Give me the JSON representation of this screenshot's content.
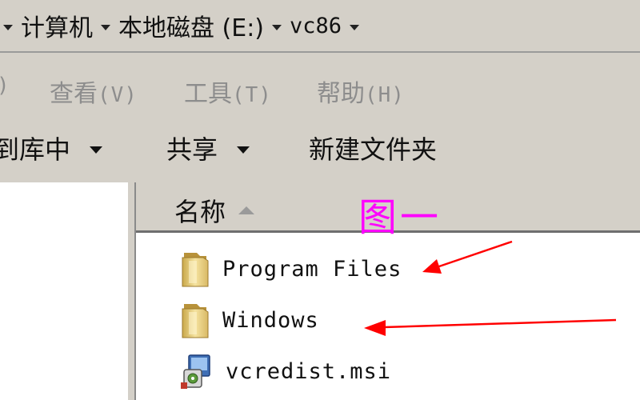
{
  "address_bar": {
    "crumbs": [
      "计算机",
      "本地磁盘 (E:)",
      "vc86"
    ]
  },
  "menu_bar": {
    "items": [
      {
        "label": "",
        "key": ")"
      },
      {
        "label": "查看",
        "key": "(V)"
      },
      {
        "label": "工具",
        "key": "(T)"
      },
      {
        "label": "帮助",
        "key": "(H)"
      }
    ]
  },
  "toolbar": {
    "include_label": "到库中",
    "share_label": "共享",
    "new_folder_label": "新建文件夹"
  },
  "file_list": {
    "column_name": "名称",
    "annotation": "图一",
    "files": [
      {
        "name": "Program Files",
        "icon": "folder-icon"
      },
      {
        "name": "Windows",
        "icon": "folder-icon"
      },
      {
        "name": "vcredist.msi",
        "icon": "msi-installer-icon"
      }
    ]
  },
  "colors": {
    "window_bg": "#d4d0c8",
    "annotation": "#ff00ff",
    "arrow": "#ff0000"
  }
}
